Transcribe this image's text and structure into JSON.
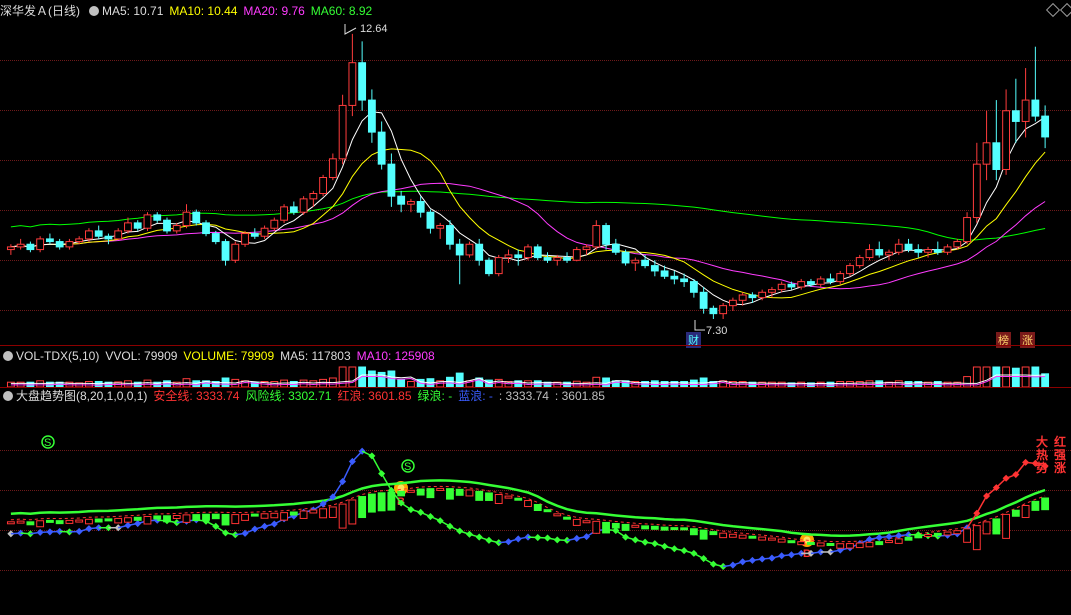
{
  "price_panel": {
    "title": "深华发Ａ(日线)",
    "ma5_label": "MA5: 10.71",
    "ma10_label": "MA10: 10.44",
    "ma20_label": "MA20: 9.76",
    "ma60_label": "MA60: 8.92",
    "high_marker": "12.64",
    "low_marker": "7.30",
    "badge_cai": "财",
    "badge_bang": "榜",
    "badge_zhang": "涨",
    "colors": {
      "up": "#ff3c3c",
      "down": "#54ffff",
      "ma5": "#ffffff",
      "ma10": "#ffff00",
      "ma20": "#ff3cff",
      "ma60": "#00ff00"
    }
  },
  "volume_panel": {
    "name": "VOL-TDX(5,10)",
    "vvol_label": "VVOL: 79909",
    "volume_label": "VOLUME: 79909",
    "ma5_label": "MA5: 117803",
    "ma10_label": "MA10: 125908"
  },
  "trend_panel": {
    "name": "大盘趋势图(8,20,1,0,0,1)",
    "safe_label": "安全线: 3333.74",
    "risk_label": "风险线: 3302.71",
    "red_wave_label": "红浪: 3601.85",
    "green_wave_label": "绿浪: -",
    "blue_wave_label": "蓝浪: -",
    "v1": ": 3333.74",
    "v2": ": 3601.85",
    "buy_mark": "B",
    "sell_mark": "S",
    "side_text": [
      "大",
      "红",
      "热",
      "强",
      "势",
      "涨"
    ]
  },
  "chart_data": {
    "type": "candlestick",
    "price_range": [
      7.3,
      12.64
    ],
    "candles": [
      [
        8.6,
        8.7,
        8.5,
        8.65
      ],
      [
        8.65,
        8.8,
        8.6,
        8.7
      ],
      [
        8.7,
        8.75,
        8.55,
        8.6
      ],
      [
        8.6,
        8.85,
        8.55,
        8.8
      ],
      [
        8.8,
        8.9,
        8.7,
        8.75
      ],
      [
        8.75,
        8.8,
        8.6,
        8.65
      ],
      [
        8.65,
        8.8,
        8.6,
        8.75
      ],
      [
        8.75,
        8.85,
        8.7,
        8.8
      ],
      [
        8.8,
        9.0,
        8.75,
        8.95
      ],
      [
        8.95,
        9.05,
        8.8,
        8.85
      ],
      [
        8.85,
        8.9,
        8.7,
        8.8
      ],
      [
        8.8,
        9.0,
        8.78,
        8.95
      ],
      [
        8.95,
        9.2,
        8.9,
        9.1
      ],
      [
        9.1,
        9.15,
        8.95,
        9.0
      ],
      [
        9.0,
        9.3,
        8.95,
        9.25
      ],
      [
        9.25,
        9.3,
        9.1,
        9.15
      ],
      [
        9.15,
        9.2,
        8.9,
        8.95
      ],
      [
        8.95,
        9.1,
        8.9,
        9.05
      ],
      [
        9.05,
        9.45,
        9.0,
        9.3
      ],
      [
        9.3,
        9.35,
        9.05,
        9.1
      ],
      [
        9.1,
        9.15,
        8.85,
        8.9
      ],
      [
        8.9,
        8.95,
        8.7,
        8.75
      ],
      [
        8.75,
        8.8,
        8.3,
        8.4
      ],
      [
        8.4,
        8.75,
        8.35,
        8.7
      ],
      [
        8.7,
        8.95,
        8.65,
        8.9
      ],
      [
        8.9,
        9.0,
        8.8,
        8.85
      ],
      [
        8.85,
        9.05,
        8.8,
        9.0
      ],
      [
        9.0,
        9.2,
        8.95,
        9.15
      ],
      [
        9.15,
        9.45,
        9.1,
        9.4
      ],
      [
        9.4,
        9.5,
        9.25,
        9.3
      ],
      [
        9.3,
        9.6,
        9.25,
        9.55
      ],
      [
        9.55,
        9.7,
        9.4,
        9.65
      ],
      [
        9.65,
        10.0,
        9.6,
        9.95
      ],
      [
        9.95,
        10.4,
        9.9,
        10.3
      ],
      [
        10.3,
        11.5,
        10.2,
        11.3
      ],
      [
        11.3,
        12.64,
        11.1,
        12.1
      ],
      [
        12.1,
        12.5,
        11.2,
        11.4
      ],
      [
        11.4,
        11.6,
        10.6,
        10.8
      ],
      [
        10.8,
        11.0,
        10.1,
        10.2
      ],
      [
        10.2,
        10.4,
        9.4,
        9.6
      ],
      [
        9.6,
        9.7,
        9.3,
        9.45
      ],
      [
        9.45,
        9.55,
        9.3,
        9.5
      ],
      [
        9.5,
        9.6,
        9.2,
        9.3
      ],
      [
        9.3,
        9.35,
        8.9,
        9.0
      ],
      [
        9.0,
        9.1,
        8.8,
        9.05
      ],
      [
        9.05,
        9.15,
        8.6,
        8.7
      ],
      [
        8.7,
        8.8,
        7.95,
        8.5
      ],
      [
        8.5,
        8.75,
        8.45,
        8.7
      ],
      [
        8.7,
        8.8,
        8.3,
        8.4
      ],
      [
        8.4,
        8.45,
        8.1,
        8.15
      ],
      [
        8.15,
        8.5,
        8.1,
        8.45
      ],
      [
        8.45,
        8.6,
        8.35,
        8.5
      ],
      [
        8.5,
        8.6,
        8.3,
        8.45
      ],
      [
        8.45,
        8.7,
        8.4,
        8.65
      ],
      [
        8.65,
        8.7,
        8.4,
        8.45
      ],
      [
        8.45,
        8.55,
        8.35,
        8.4
      ],
      [
        8.4,
        8.5,
        8.3,
        8.45
      ],
      [
        8.45,
        8.55,
        8.35,
        8.4
      ],
      [
        8.4,
        8.65,
        8.38,
        8.6
      ],
      [
        8.6,
        8.7,
        8.5,
        8.65
      ],
      [
        8.65,
        9.15,
        8.6,
        9.05
      ],
      [
        9.05,
        9.1,
        8.6,
        8.7
      ],
      [
        8.7,
        8.8,
        8.5,
        8.55
      ],
      [
        8.55,
        8.6,
        8.3,
        8.35
      ],
      [
        8.35,
        8.45,
        8.2,
        8.4
      ],
      [
        8.4,
        8.5,
        8.25,
        8.3
      ],
      [
        8.3,
        8.4,
        8.1,
        8.2
      ],
      [
        8.2,
        8.3,
        8.05,
        8.1
      ],
      [
        8.1,
        8.2,
        7.95,
        8.05
      ],
      [
        8.05,
        8.15,
        7.9,
        8.0
      ],
      [
        8.0,
        8.05,
        7.7,
        7.8
      ],
      [
        7.8,
        7.9,
        7.4,
        7.5
      ],
      [
        7.5,
        7.55,
        7.3,
        7.4
      ],
      [
        7.4,
        7.6,
        7.3,
        7.55
      ],
      [
        7.55,
        7.7,
        7.45,
        7.65
      ],
      [
        7.65,
        7.8,
        7.55,
        7.75
      ],
      [
        7.75,
        7.8,
        7.6,
        7.7
      ],
      [
        7.7,
        7.85,
        7.65,
        7.8
      ],
      [
        7.8,
        7.9,
        7.7,
        7.85
      ],
      [
        7.85,
        8.0,
        7.8,
        7.95
      ],
      [
        7.95,
        8.0,
        7.85,
        7.9
      ],
      [
        7.9,
        8.05,
        7.85,
        8.0
      ],
      [
        8.0,
        8.05,
        7.9,
        7.95
      ],
      [
        7.95,
        8.1,
        7.9,
        8.05
      ],
      [
        8.05,
        8.15,
        7.95,
        8.0
      ],
      [
        8.0,
        8.2,
        7.95,
        8.15
      ],
      [
        8.15,
        8.35,
        8.1,
        8.3
      ],
      [
        8.3,
        8.5,
        8.25,
        8.45
      ],
      [
        8.45,
        8.7,
        8.4,
        8.6
      ],
      [
        8.6,
        8.75,
        8.45,
        8.5
      ],
      [
        8.5,
        8.6,
        8.4,
        8.55
      ],
      [
        8.55,
        8.8,
        8.5,
        8.7
      ],
      [
        8.7,
        8.8,
        8.55,
        8.6
      ],
      [
        8.6,
        8.7,
        8.45,
        8.55
      ],
      [
        8.55,
        8.65,
        8.45,
        8.6
      ],
      [
        8.6,
        8.75,
        8.5,
        8.55
      ],
      [
        8.55,
        8.7,
        8.5,
        8.65
      ],
      [
        8.65,
        8.8,
        8.6,
        8.75
      ],
      [
        8.75,
        9.3,
        8.7,
        9.2
      ],
      [
        9.2,
        10.6,
        9.1,
        10.2
      ],
      [
        10.2,
        11.2,
        9.9,
        10.6
      ],
      [
        10.6,
        11.4,
        9.9,
        10.1
      ],
      [
        10.1,
        11.6,
        10.0,
        11.2
      ],
      [
        11.2,
        11.8,
        10.6,
        11.0
      ],
      [
        11.0,
        12.0,
        10.7,
        11.4
      ],
      [
        11.4,
        12.4,
        11.0,
        11.1
      ],
      [
        11.1,
        11.3,
        10.5,
        10.71
      ]
    ]
  }
}
